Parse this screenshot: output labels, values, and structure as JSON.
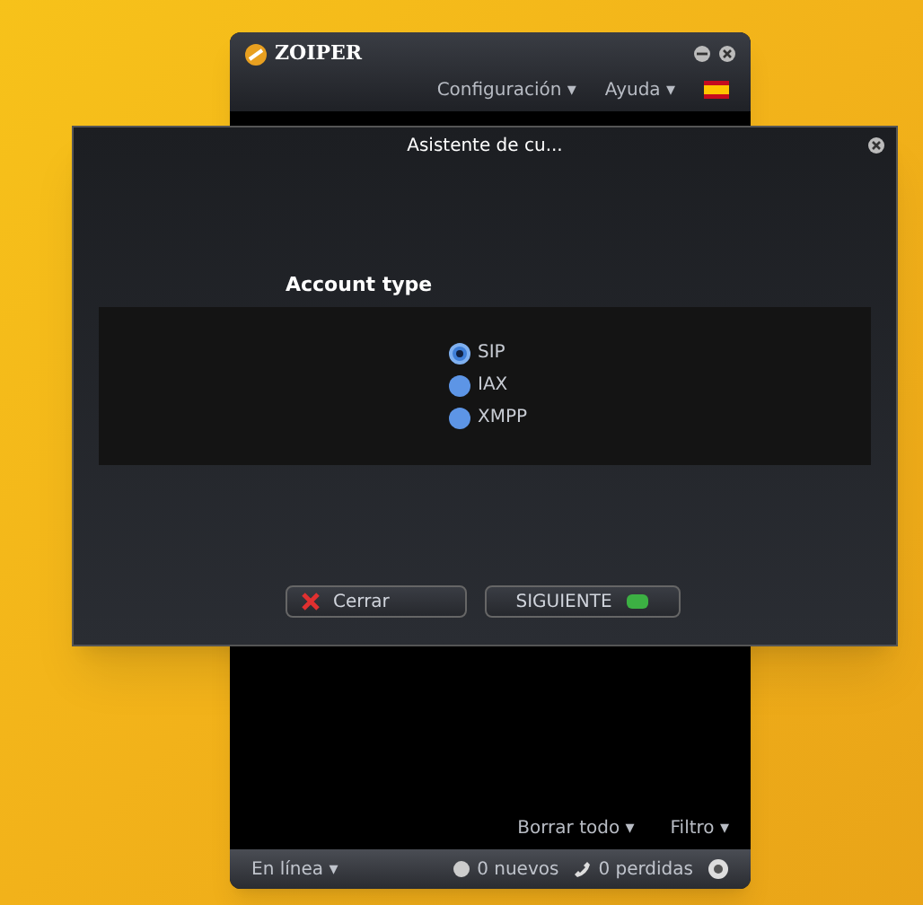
{
  "main_window": {
    "title": "ZOIPER",
    "menu": [
      "Configuración ▾",
      "Ayuda ▾"
    ],
    "history_actions": [
      "Borrar todo ▾",
      "Filtro ▾"
    ],
    "status_bar": {
      "presence": "En línea ▾",
      "new_messages": "0 nuevos",
      "missed_calls": "0 perdidas"
    }
  },
  "dialog": {
    "title": "Asistente de cu...",
    "section_label": "Account type",
    "options": [
      {
        "label": "SIP",
        "selected": true
      },
      {
        "label": "IAX",
        "selected": false
      },
      {
        "label": "XMPP",
        "selected": false
      }
    ],
    "buttons": [
      {
        "label": "Cerrar",
        "kind": "close"
      },
      {
        "label": "SIGUIENTE",
        "kind": "next"
      }
    ]
  }
}
